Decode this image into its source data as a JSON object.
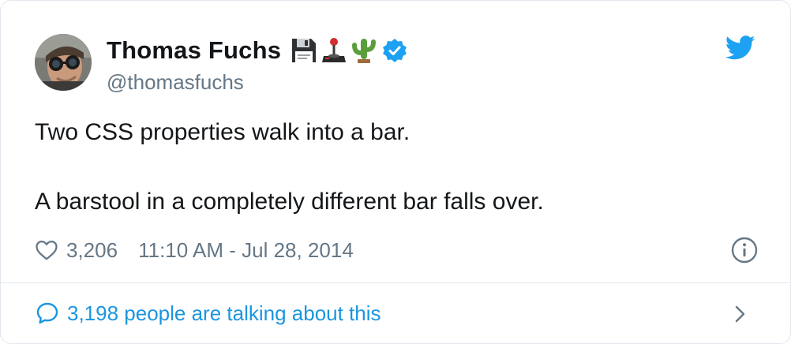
{
  "author": {
    "display_name": "Thomas Fuchs",
    "handle": "@thomasfuchs",
    "emojis": [
      "floppy-disk-icon",
      "joystick-icon",
      "cactus-icon"
    ],
    "verified": true
  },
  "tweet": {
    "lines": [
      "Two CSS properties walk into a bar.",
      "A barstool in a completely different bar falls over."
    ],
    "like_count": "3,206",
    "timestamp": "11:10 AM - Jul 28, 2014"
  },
  "footer": {
    "talking_text": "3,198 people are talking about this"
  },
  "colors": {
    "accent": "#1b95e0",
    "muted": "#657786",
    "verified": "#1da1f2",
    "border": "#e1e8ed"
  }
}
